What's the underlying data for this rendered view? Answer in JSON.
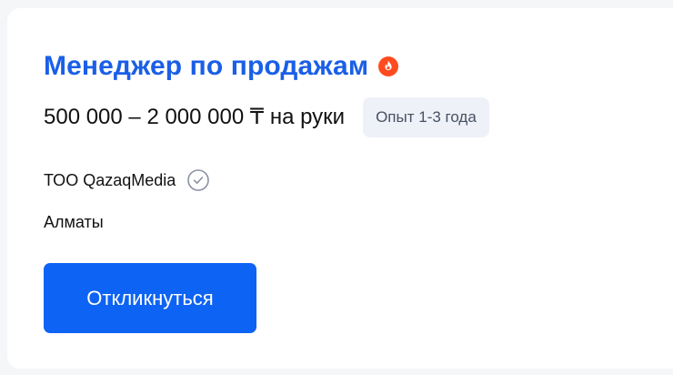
{
  "vacancy": {
    "title": "Менеджер по продажам",
    "hot_icon": "fire-icon",
    "salary": "500 000 – 2 000 000 ₸ на руки",
    "experience": "Опыт 1-3 года",
    "company": "ТОО QazaqMedia",
    "verified_icon": "check-circle-icon",
    "city": "Алматы",
    "apply_label": "Откликнуться"
  },
  "colors": {
    "title": "#1a5fe6",
    "button": "#0d63f3",
    "hot": "#ff4b1f",
    "badge_bg": "#eef1f7"
  }
}
